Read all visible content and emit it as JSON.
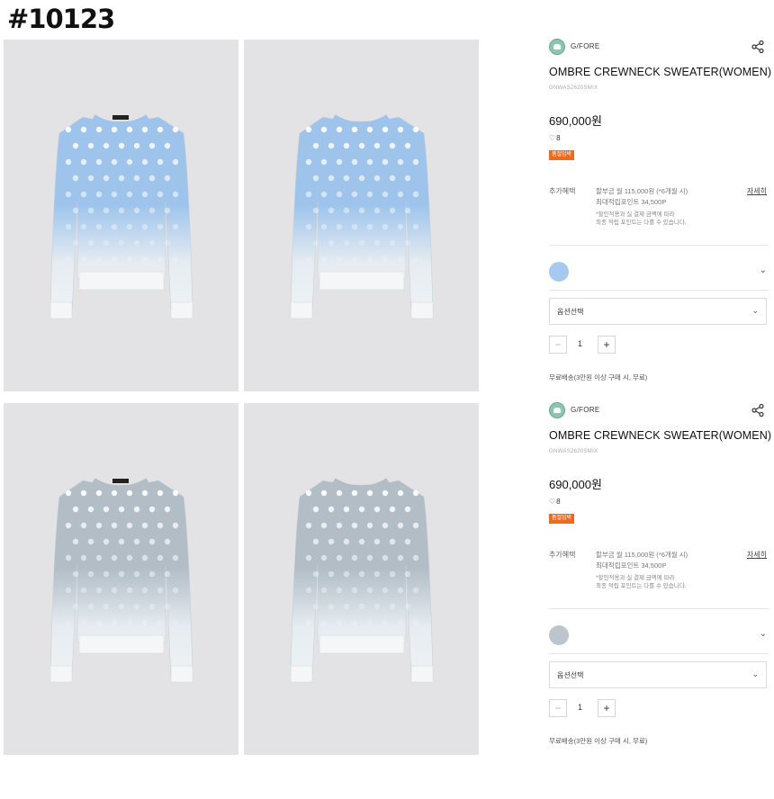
{
  "code_label": "#10123",
  "photos": [
    {
      "color": "blue"
    },
    {
      "color": "blue"
    },
    {
      "color": "gray"
    },
    {
      "color": "gray"
    }
  ],
  "panels": [
    {
      "brand": "G/FORE",
      "title": "OMBRE CREWNECK SWEATER(WOMEN)",
      "sku": "GNWAS2620SMIX",
      "price": "690,000원",
      "likes": "8",
      "badge": "품절임박",
      "benefit_label": "추가혜택",
      "benefit_line1": "할부금 월 115,000원 (*6개월 시)",
      "benefit_line2": "최대적립포인트 34,500P",
      "benefit_note1": "*할인적용과 실 결제 금액에 따라",
      "benefit_note2": "최종 적립 포인트는 다를 수 있습니다.",
      "detail_link": "자세히",
      "swatch_color": "#a8c9ef",
      "select_label": "옵션선택",
      "quantity": "1",
      "shipping": "무료배송(3만원 이상 구매 시, 무료)"
    },
    {
      "brand": "G/FORE",
      "title": "OMBRE CREWNECK SWEATER(WOMEN)",
      "sku": "GNWAS2620SMIX",
      "price": "690,000원",
      "likes": "8",
      "badge": "품절임박",
      "benefit_label": "추가혜택",
      "benefit_line1": "할부금 월 115,000원 (*6개월 시)",
      "benefit_line2": "최대적립포인트 34,500P",
      "benefit_note1": "*할인적용과 실 결제 금액에 따라",
      "benefit_note2": "최종 적립 포인트는 다를 수 있습니다.",
      "detail_link": "자세히",
      "swatch_color": "#bcc4cc",
      "select_label": "옵션선택",
      "quantity": "1",
      "shipping": "무료배송(3만원 이상 구매 시, 무료)"
    }
  ],
  "colors": {
    "blue_top": "#9ec4ec",
    "gray_top": "#b2bdc6",
    "badge": "#ee6a1f"
  }
}
